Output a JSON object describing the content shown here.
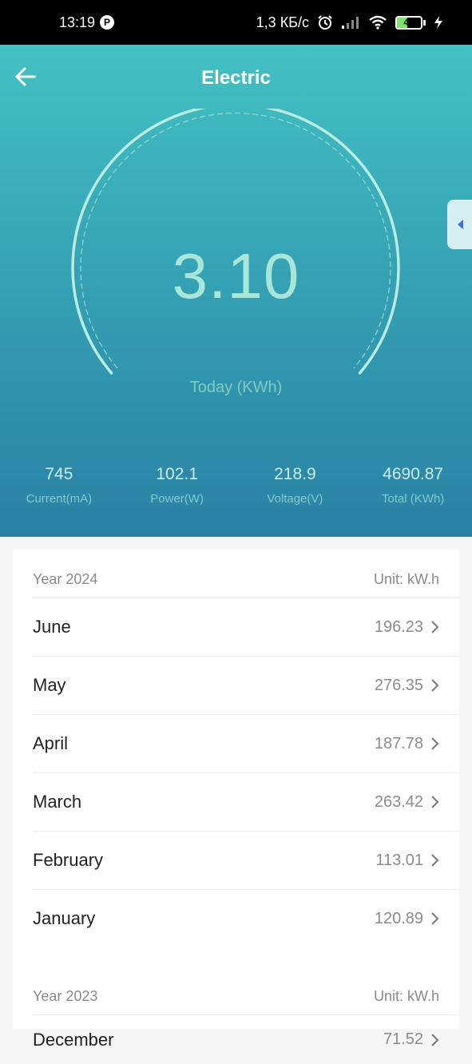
{
  "status_bar": {
    "time": "13:19",
    "app_icon": "P",
    "network_speed": "1,3 КБ/с",
    "battery": "43",
    "battery_level": 0.43,
    "icons": [
      "alarm-icon",
      "signal-icon",
      "wifi-icon",
      "battery-icon",
      "charging-icon"
    ]
  },
  "header": {
    "title": "Electric"
  },
  "gauge": {
    "value": "3.10",
    "label": "Today (KWh)"
  },
  "stats": [
    {
      "value": "745",
      "label": "Current(mA)"
    },
    {
      "value": "102.1",
      "label": "Power(W)"
    },
    {
      "value": "218.9",
      "label": "Voltage(V)"
    },
    {
      "value": "4690.87",
      "label": "Total (KWh)"
    }
  ],
  "history": {
    "year_2024": {
      "title": "Year 2024",
      "unit": "Unit: kW.h",
      "months": [
        {
          "name": "June",
          "value": "196.23"
        },
        {
          "name": "May",
          "value": "276.35"
        },
        {
          "name": "April",
          "value": "187.78"
        },
        {
          "name": "March",
          "value": "263.42"
        },
        {
          "name": "February",
          "value": "113.01"
        },
        {
          "name": "January",
          "value": "120.89"
        }
      ]
    },
    "year_2023": {
      "title": "Year 2023",
      "unit": "Unit: kW.h",
      "months": [
        {
          "name": "December",
          "value": "71.52"
        }
      ]
    }
  },
  "colors": {
    "hero_top": "#43c1c3",
    "hero_bottom": "#2a81a4",
    "gauge_text": "#a7e6d8",
    "side_tab_arrow": "#3d6fe0"
  }
}
